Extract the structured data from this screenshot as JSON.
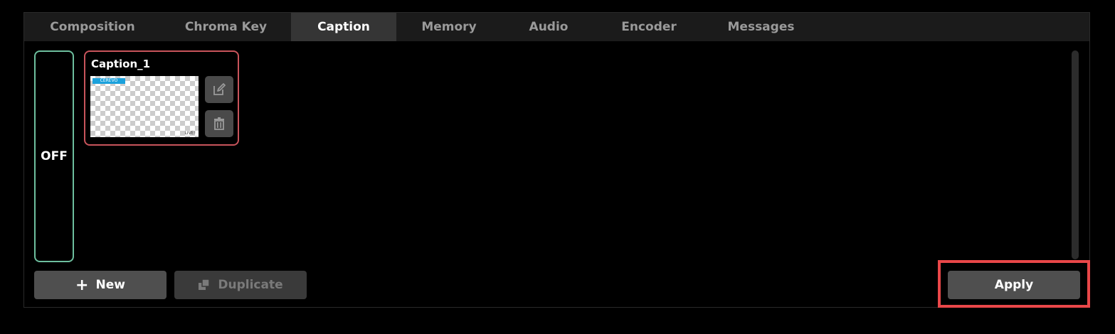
{
  "tabs": [
    {
      "label": "Composition"
    },
    {
      "label": "Chroma Key"
    },
    {
      "label": "Caption"
    },
    {
      "label": "Memory"
    },
    {
      "label": "Audio"
    },
    {
      "label": "Encoder"
    },
    {
      "label": "Messages"
    }
  ],
  "active_tab": "Caption",
  "toggle": {
    "label": "OFF"
  },
  "caption_card": {
    "title": "Caption_1",
    "thumbnail_logo": "CEREVO",
    "thumbnail_badge": "LIVE!"
  },
  "buttons": {
    "new_icon": "+",
    "new_label": "New",
    "duplicate_label": "Duplicate",
    "apply_label": "Apply"
  },
  "colors": {
    "off_border": "#6dbf9e",
    "card_border": "#c8545b",
    "highlight": "#e94749",
    "logo": "#1ba1dc"
  },
  "icons": [
    "edit-icon",
    "trash-icon",
    "duplicate-icon"
  ]
}
